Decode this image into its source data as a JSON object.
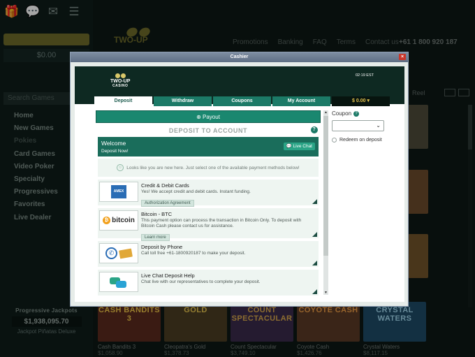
{
  "background": {
    "balance": "$0.00",
    "search_placeholder": "Search Games",
    "nav_items": [
      "Home",
      "New Games",
      "Pokies",
      "Card Games",
      "Video Poker",
      "Specialty",
      "Progressives",
      "Favorites",
      "Live Dealer"
    ],
    "logo_text": "TWO-UP",
    "top_links": [
      "Promotions",
      "Banking",
      "FAQ",
      "Terms",
      "Contact us"
    ],
    "phone": "+61 1 800 920 187",
    "reel_label": "Reel",
    "jackpot": {
      "title": "Progressive Jackpots",
      "value": "$1,938,095.70",
      "game": "Jackpot Piñatas Deluxe"
    },
    "games": [
      {
        "name": "Cash Bandits 3",
        "amount": "$1,058.90",
        "art": "CASH BANDITS 3"
      },
      {
        "name": "Cleopatra's Gold",
        "amount": "$1,378.73",
        "art": "GOLD"
      },
      {
        "name": "Count Spectacular",
        "amount": "$3,749.10",
        "art": "COUNT SPECTACULAR"
      },
      {
        "name": "Coyote Cash",
        "amount": "$1,426.76",
        "art": "COYOTE CASH"
      },
      {
        "name": "Crystal Waters",
        "amount": "$8,117.15",
        "art": "CRYSTAL WATERS"
      }
    ]
  },
  "modal": {
    "title": "Cashier",
    "close": "×",
    "logo_main": "TWO-UP",
    "logo_sub": "CASINO",
    "time": "02:19 EST",
    "tabs": [
      "Deposit",
      "Withdraw",
      "Coupons",
      "My Account",
      "$ 0.00 ▾"
    ],
    "payout_label": "⊕ Payout",
    "section_title": "DEPOSIT TO ACCOUNT",
    "help": "?",
    "welcome": {
      "title": "Welcome",
      "subtitle": "Deposit Now!",
      "chat_button": "Live Chat"
    },
    "notice": "Looks like you are new here. Just select one of the available payment methods below!",
    "methods": [
      {
        "title": "Credit & Debit Cards",
        "desc": "Yes! We accept credit and debit cards. Instant funding.",
        "link": "Authorization Agreement",
        "icon": "amex-card-icon",
        "logo": "AMEX"
      },
      {
        "title": "Bitcoin - BTC",
        "desc": "This payment option can process the transaction in Bitcoin Only. To deposit with Bitcoin Cash please contact us for assistance.",
        "link": "Learn more",
        "icon": "bitcoin-icon",
        "logo": "bitcoin"
      },
      {
        "title": "Deposit by Phone",
        "desc": "Call toll free +61-1800920187 to make your deposit.",
        "icon": "phone-deposit-icon"
      },
      {
        "title": "Live Chat Deposit Help",
        "desc": "Chat live with our representatives to complete your deposit.",
        "icon": "live-chat-icon"
      }
    ],
    "coupon": {
      "label": "Coupon",
      "redeem": "Redeem on deposit"
    }
  },
  "colors": {
    "accent": "#1c7a67",
    "dark": "#0e2922",
    "gold": "#e3c24e"
  }
}
